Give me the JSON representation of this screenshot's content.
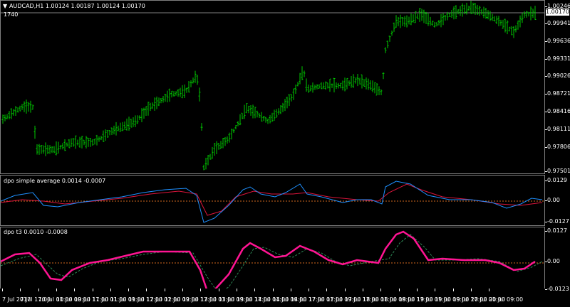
{
  "main": {
    "symbol_label": "AUDCAD,H1  1.00124 1.00187 1.00124 1.00170",
    "number_label": "1740",
    "current_price": "1.00170",
    "ticks": [
      "1.00246",
      "0.99941",
      "0.99636",
      "0.99331",
      "0.99026",
      "0.98721",
      "0.98416",
      "0.98111",
      "0.97806",
      "0.97501"
    ],
    "bar_color": "#00c800"
  },
  "ind1": {
    "title": "dpo simple average 0.0014 -0.0007",
    "ticks": [
      "0.0129",
      "0.00",
      "-0.0127"
    ],
    "colors": {
      "fast": "#1e90ff",
      "slow": "#dc143c",
      "zero": "#d2691e"
    }
  },
  "ind2": {
    "title": "dpo t3 0.0010 -0.0008",
    "ticks": [
      "0.0127",
      "0.00",
      "-0.0123"
    ],
    "colors": {
      "main": "#ff1493",
      "signal": "#2e8b57",
      "zero": "#d2691e"
    }
  },
  "time_axis": [
    "7 Jul 2017",
    "7 Jul 17:00",
    "10 Jul 01:00",
    "10 Jul 09:00",
    "10 Jul 17:00",
    "11 Jul 01:00",
    "11 Jul 09:00",
    "11 Jul 17:00",
    "12 Jul 01:00",
    "12 Jul 09:00",
    "12 Jul 17:00",
    "13 Jul 01:00",
    "13 Jul 09:00",
    "13 Jul 17:00",
    "14 Jul 01:00",
    "14 Jul 09:00",
    "14 Jul 17:00",
    "17 Jul 01:00",
    "17 Jul 09:00",
    "17 Jul 17:00",
    "18 Jul 01:00",
    "18 Jul 09:00",
    "18 Jul 17:00",
    "19 Jul 01:00",
    "19 Jul 09:00",
    "19 Jul 17:00",
    "20 Jul 01:00",
    "20 Jul 09:00"
  ]
}
